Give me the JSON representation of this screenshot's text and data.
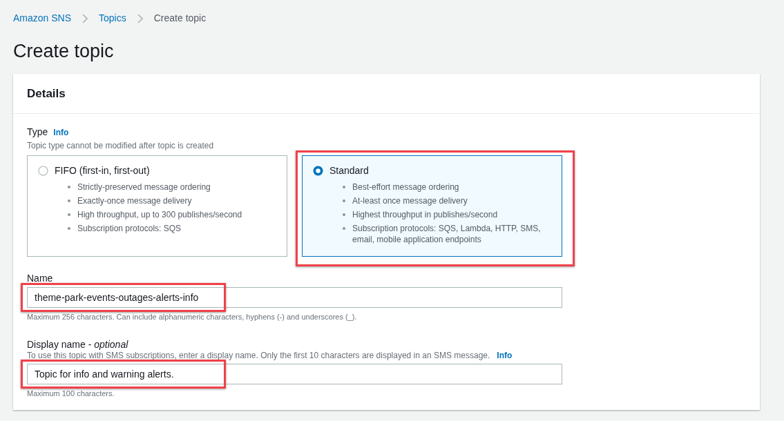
{
  "breadcrumbs": [
    {
      "label": "Amazon SNS",
      "kind": "link"
    },
    {
      "label": "Topics",
      "kind": "link"
    },
    {
      "label": "Create topic",
      "kind": "current"
    }
  ],
  "page_title": "Create topic",
  "panel": {
    "title": "Details",
    "type_field": {
      "label": "Type",
      "info": "Info",
      "description": "Topic type cannot be modified after topic is created",
      "options": [
        {
          "label": "FIFO (first-in, first-out)",
          "selected": false,
          "highlighted": false,
          "features": [
            "Strictly-preserved message ordering",
            "Exactly-once message delivery",
            "High throughput, up to 300 publishes/second",
            "Subscription protocols: SQS"
          ]
        },
        {
          "label": "Standard",
          "selected": true,
          "highlighted": true,
          "features": [
            "Best-effort message ordering",
            "At-least once message delivery",
            "Highest throughput in publishes/second",
            "Subscription protocols: SQS, Lambda, HTTP, SMS, email, mobile application endpoints"
          ]
        }
      ]
    },
    "fields": [
      {
        "label": "Name",
        "value": "theme-park-events-outages-alerts-info",
        "highlighted": true,
        "hint": "Maximum 256 characters. Can include alphanumeric characters, hyphens (-) and underscores (_)."
      },
      {
        "label": "Display name - *optional*",
        "description": "To use this topic with SMS subscriptions, enter a display name. Only the first 10 characters are displayed in an SMS message.",
        "info": "Info",
        "value": "Topic for info and warning alerts.",
        "highlighted": true,
        "hint": "Maximum 100 characters."
      }
    ]
  }
}
